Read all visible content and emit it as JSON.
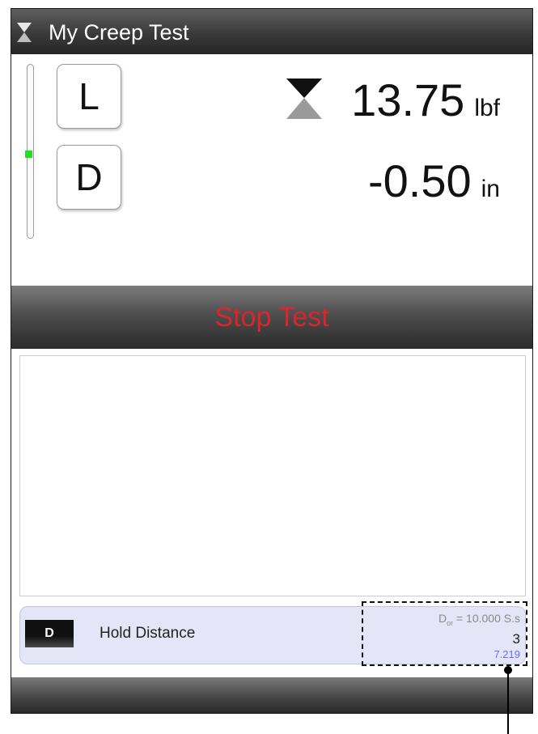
{
  "header": {
    "title": "My Creep Test",
    "icon": "hourglass-icon"
  },
  "channels": [
    {
      "button_label": "L",
      "value": "13.75",
      "unit": "lbf",
      "tare_icon": "tare-icon"
    },
    {
      "button_label": "D",
      "value": "-0.50",
      "unit": "in"
    }
  ],
  "level_indicator": {
    "color": "#22dd22"
  },
  "stop_button": {
    "label": "Stop Test",
    "color": "#d8262a"
  },
  "step": {
    "tag": "D",
    "name": "Hold Distance",
    "info_line1_main": "D",
    "info_line1_sub": "or",
    "info_line1_rest": " = 10.000 S.s",
    "info_line2": "3",
    "info_line3": "7.219",
    "info_line3_color": "#6a6aff"
  }
}
